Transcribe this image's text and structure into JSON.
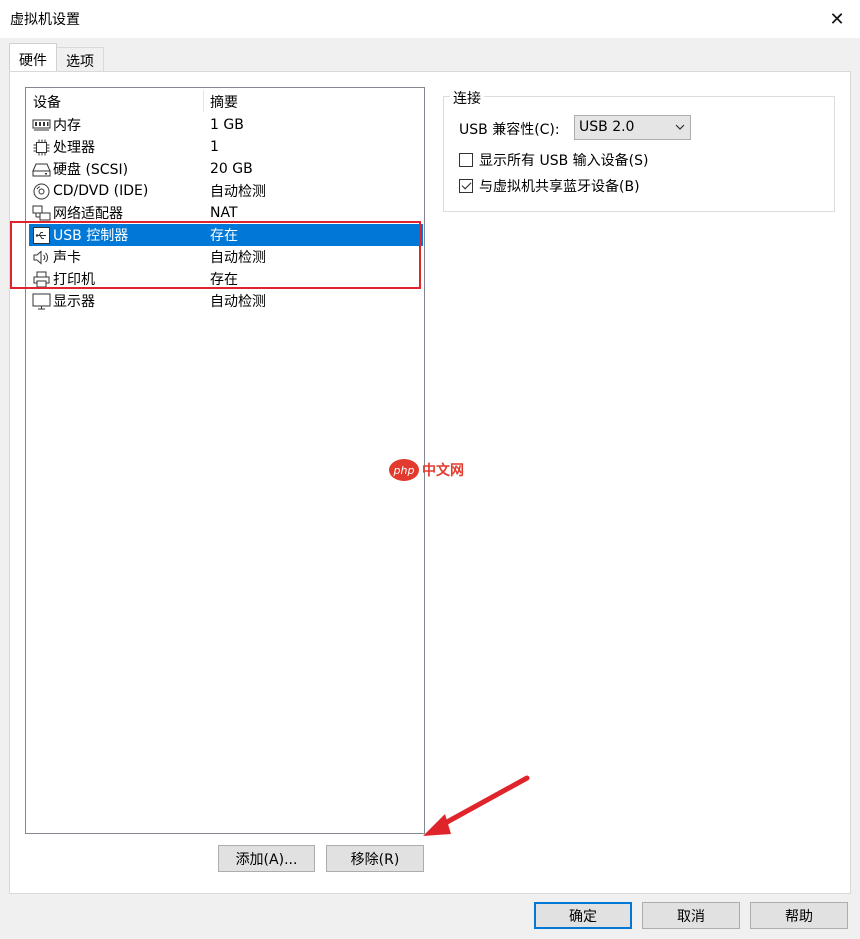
{
  "window": {
    "title": "虚拟机设置",
    "close_glyph": "✕"
  },
  "tabs": [
    {
      "label": "硬件",
      "active": true
    },
    {
      "label": "选项",
      "active": false
    }
  ],
  "device_list": {
    "columns": [
      "设备",
      "摘要"
    ],
    "rows": [
      {
        "name": "内存",
        "summary": "1 GB",
        "icon": "memory-icon"
      },
      {
        "name": "处理器",
        "summary": "1",
        "icon": "processor-icon"
      },
      {
        "name": "硬盘 (SCSI)",
        "summary": "20 GB",
        "icon": "harddisk-icon"
      },
      {
        "name": "CD/DVD (IDE)",
        "summary": "自动检测",
        "icon": "cd-dvd-icon"
      },
      {
        "name": "网络适配器",
        "summary": "NAT",
        "icon": "network-adapter-icon"
      },
      {
        "name": "USB 控制器",
        "summary": "存在",
        "icon": "usb-icon",
        "selected": true
      },
      {
        "name": "声卡",
        "summary": "自动检测",
        "icon": "speaker-icon"
      },
      {
        "name": "打印机",
        "summary": "存在",
        "icon": "printer-icon"
      },
      {
        "name": "显示器",
        "summary": "自动检测",
        "icon": "monitor-icon"
      }
    ]
  },
  "connection": {
    "group_title": "连接",
    "compat_label": "USB 兼容性(C):",
    "compat_value": "USB 2.0",
    "show_all_usb_label": "显示所有 USB 输入设备(S)",
    "show_all_usb_checked": false,
    "share_bt_label": "与虚拟机共享蓝牙设备(B)",
    "share_bt_checked": true
  },
  "list_buttons": {
    "add": "添加(A)...",
    "remove": "移除(R)"
  },
  "footer": {
    "ok": "确定",
    "cancel": "取消",
    "help": "帮助"
  },
  "watermark": {
    "logo": "php",
    "text": "中文网"
  },
  "colors": {
    "selection": "#0078d7",
    "highlight_box": "#e0242b",
    "arrow": "#e0242b"
  }
}
